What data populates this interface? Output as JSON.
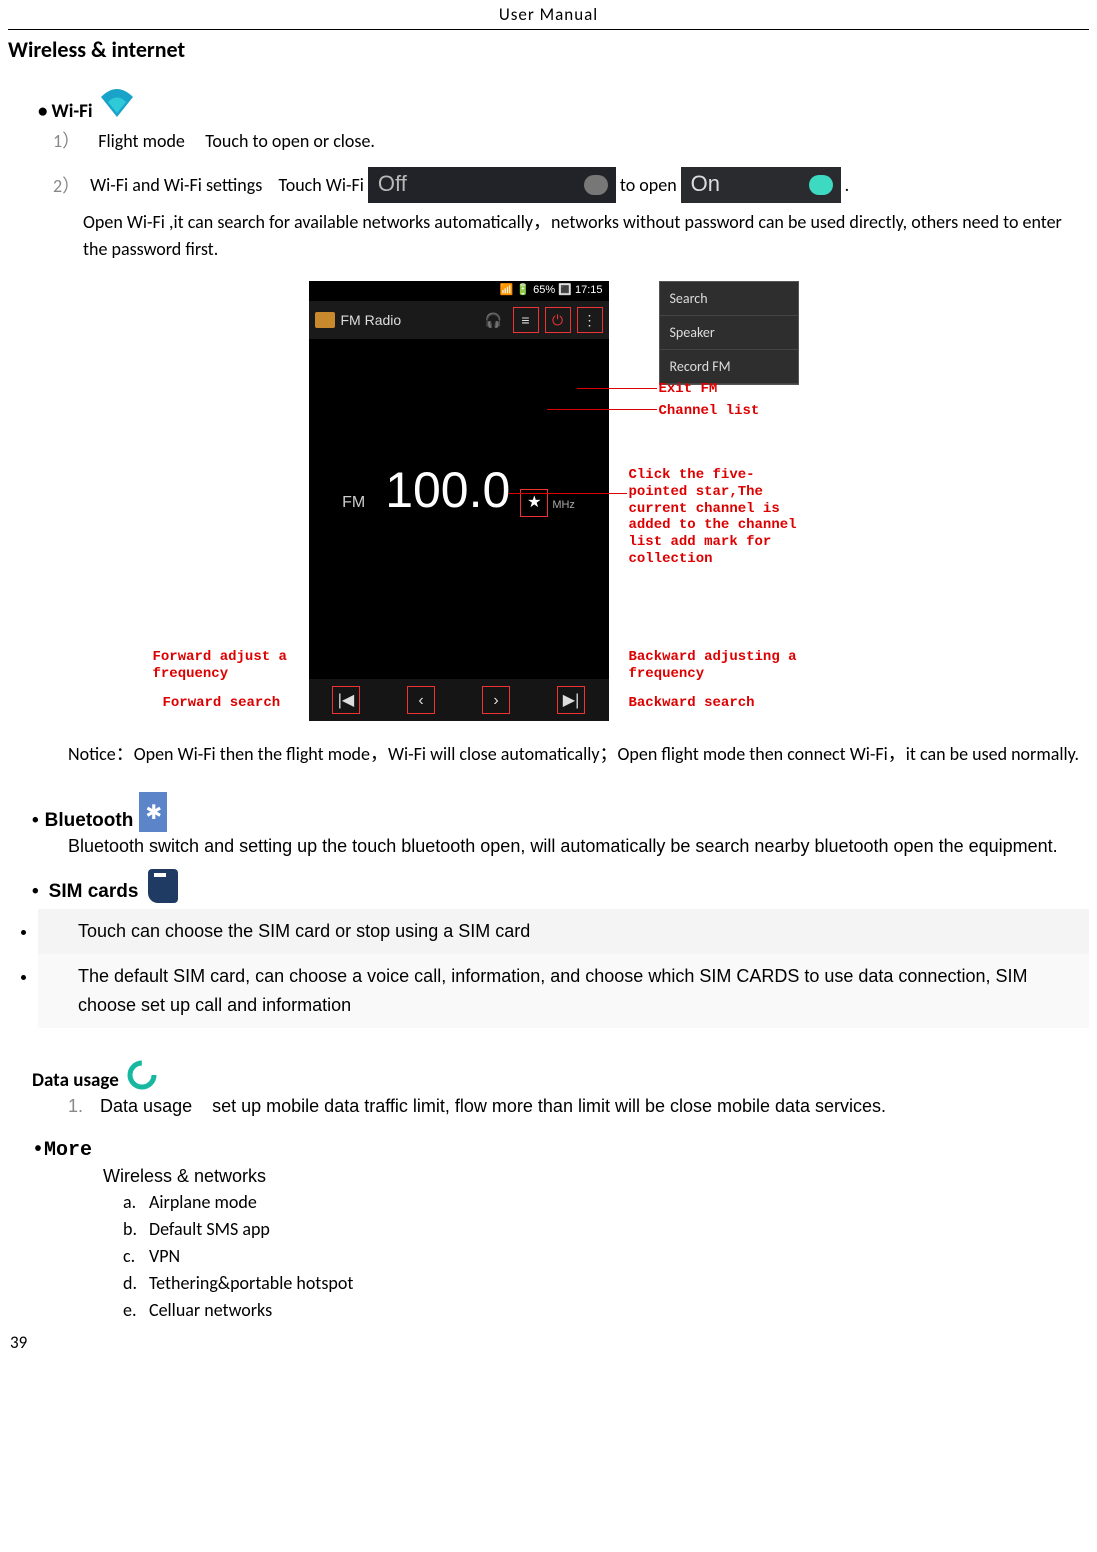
{
  "header": "User    Manual",
  "mainHeading": "Wireless & internet",
  "wifi": {
    "bullet": "•",
    "label": "Wi-Fi",
    "item1_num": "1）",
    "item1_label": "Flight mode",
    "item1_desc": "Touch to open or close.",
    "item2_num": "2）",
    "item2_label": "Wi-Fi and Wi-Fi settings",
    "item2_touch": "Touch Wi-Fi",
    "toggle_off": "Off",
    "item2_toopen": "to open",
    "toggle_on": "On",
    "item2_period": ".",
    "para": "Open Wi-Fi ,it can search for available networks automatically，networks without password can be used directly, others need to enter the password first."
  },
  "fm": {
    "status": "📶 🔋 65% 🔳 17:15",
    "title": "FM Radio",
    "fm_small": "FM",
    "freq": "100.0",
    "star": "★",
    "mhz": "MHz",
    "menu": {
      "search": "Search",
      "speaker": "Speaker",
      "record": "Record FM"
    },
    "ann_exit": "Exit  FM",
    "ann_channel": "Channel list",
    "ann_star": "Click the five-pointed star,The current channel is added to the channel list add mark for collection",
    "ann_fwd_adj": "Forward adjust a frequency",
    "ann_fwd_search": "Forward search",
    "ann_bwd_adj": "Backward adjusting a frequency",
    "ann_bwd_search": "Backward search",
    "pb_prev": "|◀",
    "pb_back": "‹",
    "pb_fwd": "›",
    "pb_next": "▶|"
  },
  "notice": "Notice：Open Wi-Fi then the flight mode，Wi-Fi will close automatically；Open flight mode then connect Wi-Fi，it can be used normally.",
  "bluetooth": {
    "bullet": "•",
    "label": "Bluetooth",
    "text": "Bluetooth switch and setting up the touch bluetooth open, will automatically be search nearby bluetooth open the equipment."
  },
  "sim": {
    "bullet": "•",
    "label": "SIM cards",
    "li1": "Touch can choose the SIM card or stop using a SIM card",
    "li2": "The default SIM card, can choose a voice call, information, and choose which SIM CARDS to use data connection, SIM choose set up call and information"
  },
  "dataUsage": {
    "label": "Data usage",
    "num": "1.",
    "name": "Data usage",
    "desc": "set up mobile data traffic limit, flow more than limit will be close mobile data services."
  },
  "more": {
    "bullet": "•",
    "label": "More",
    "sub": "Wireless & networks",
    "items": {
      "a": {
        "k": "a.",
        "v": "Airplane mode"
      },
      "b": {
        "k": "b.",
        "v": "Default SMS app"
      },
      "c": {
        "k": "c.",
        "v": "VPN"
      },
      "d": {
        "k": "d.",
        "v": "Tethering&portable hotspot"
      },
      "e": {
        "k": "e.",
        "v": "Celluar networks"
      }
    }
  },
  "pageNum": "39"
}
